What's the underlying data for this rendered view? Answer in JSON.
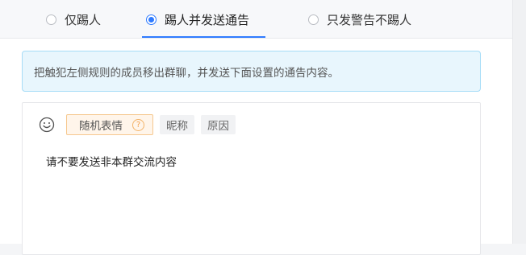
{
  "tabs": [
    {
      "label": "仅踢人",
      "selected": false
    },
    {
      "label": "踢人并发送通告",
      "selected": true
    },
    {
      "label": "只发警告不踢人",
      "selected": false
    }
  ],
  "info_banner": {
    "text": "把触犯左侧规则的成员移出群聊，并发送下面设置的通告内容。"
  },
  "editor": {
    "toolbar": {
      "emoji_icon": "smiley-icon",
      "random_emoji_label": "随机表情",
      "help_icon_glyph": "?",
      "nickname_label": "昵称",
      "reason_label": "原因"
    },
    "content": "请不要发送非本群交流内容"
  },
  "colors": {
    "accent": "#2f7bff",
    "info_bg": "#e8f6fd",
    "info_border": "#a6dcf7",
    "chip_warm_bg": "#fff5ea",
    "chip_warm_border": "#f6c88f"
  }
}
